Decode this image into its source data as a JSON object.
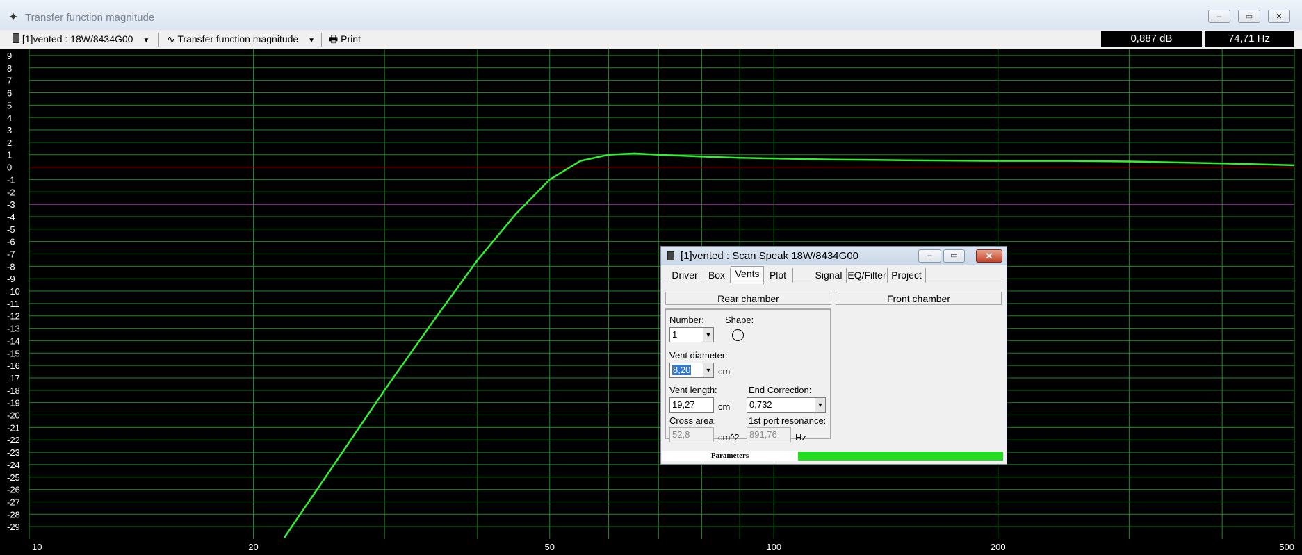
{
  "window": {
    "title": "Transfer function magnitude",
    "controls": {
      "minimize": "–",
      "maximize": "▭",
      "close": "✕"
    }
  },
  "toolbar": {
    "project_select": "[1]vented : 18W/8434G00",
    "graph_select": "Transfer function magnitude",
    "print_label": "Print",
    "readout_db": "0,887 dB",
    "readout_hz": "74,71 Hz"
  },
  "chart_data": {
    "type": "line",
    "title": "",
    "x_scale": "log",
    "xlim": [
      10,
      500
    ],
    "ylim": [
      -30,
      9.5
    ],
    "x_ticks": [
      10,
      20,
      50,
      100,
      200,
      500
    ],
    "x_tick_labels": [
      "10",
      "20",
      "50",
      "100",
      "200",
      "500"
    ],
    "y_ticks": [
      9,
      8,
      7,
      6,
      5,
      4,
      3,
      2,
      1,
      0,
      -1,
      -2,
      -3,
      -4,
      -5,
      -6,
      -7,
      -8,
      -9,
      -10,
      -11,
      -12,
      -13,
      -14,
      -15,
      -16,
      -17,
      -18,
      -19,
      -20,
      -21,
      -22,
      -23,
      -24,
      -25,
      -26,
      -27,
      -28,
      -29
    ],
    "x_grid_lines": [
      10,
      20,
      30,
      40,
      50,
      60,
      70,
      80,
      90,
      100,
      200,
      300,
      400,
      500
    ],
    "reference_lines": [
      {
        "y": 0,
        "color": "#ff2a2a"
      },
      {
        "y": -3,
        "color": "#c02bc8"
      }
    ],
    "colors": {
      "background": "#000000",
      "grid": "#1f8a1f",
      "tick_text": "#ffffff",
      "curve": "#33ee33"
    },
    "series": [
      {
        "x": [
          22.0,
          25,
          30,
          35,
          40,
          45,
          50,
          55,
          60,
          65,
          70,
          80,
          90,
          100,
          120,
          150,
          200,
          250,
          300,
          400,
          500
        ],
        "y": [
          -29.9,
          -25.0,
          -18.0,
          -12.3,
          -7.5,
          -3.8,
          -1.0,
          0.5,
          1.0,
          1.1,
          1.0,
          0.85,
          0.75,
          0.7,
          0.6,
          0.55,
          0.5,
          0.5,
          0.45,
          0.3,
          0.15
        ]
      }
    ]
  },
  "dialog": {
    "title": "[1]vented : Scan Speak 18W/8434G00",
    "tabs": [
      "Driver",
      "Box",
      "Vents",
      "Plot",
      "Signal",
      "EQ/Filter",
      "Project"
    ],
    "active_tab": "Vents",
    "chambers": {
      "rear": "Rear chamber",
      "front": "Front chamber"
    },
    "number_label": "Number:",
    "number_value": "1",
    "shape_label": "Shape:",
    "vent_diameter_label": "Vent diameter:",
    "vent_diameter_value": "8,20",
    "vent_diameter_unit": "cm",
    "vent_length_label": "Vent length:",
    "vent_length_value": "19,27",
    "vent_length_unit": "cm",
    "end_correction_label": "End Correction:",
    "end_correction_value": "0,732",
    "cross_area_label": "Cross area:",
    "cross_area_value": "52,8",
    "cross_area_unit": "cm^2",
    "port_resonance_label": "1st port resonance:",
    "port_resonance_value": "891,76",
    "port_resonance_unit": "Hz",
    "status_label": "Parameters",
    "progress_fraction": 1.0
  }
}
